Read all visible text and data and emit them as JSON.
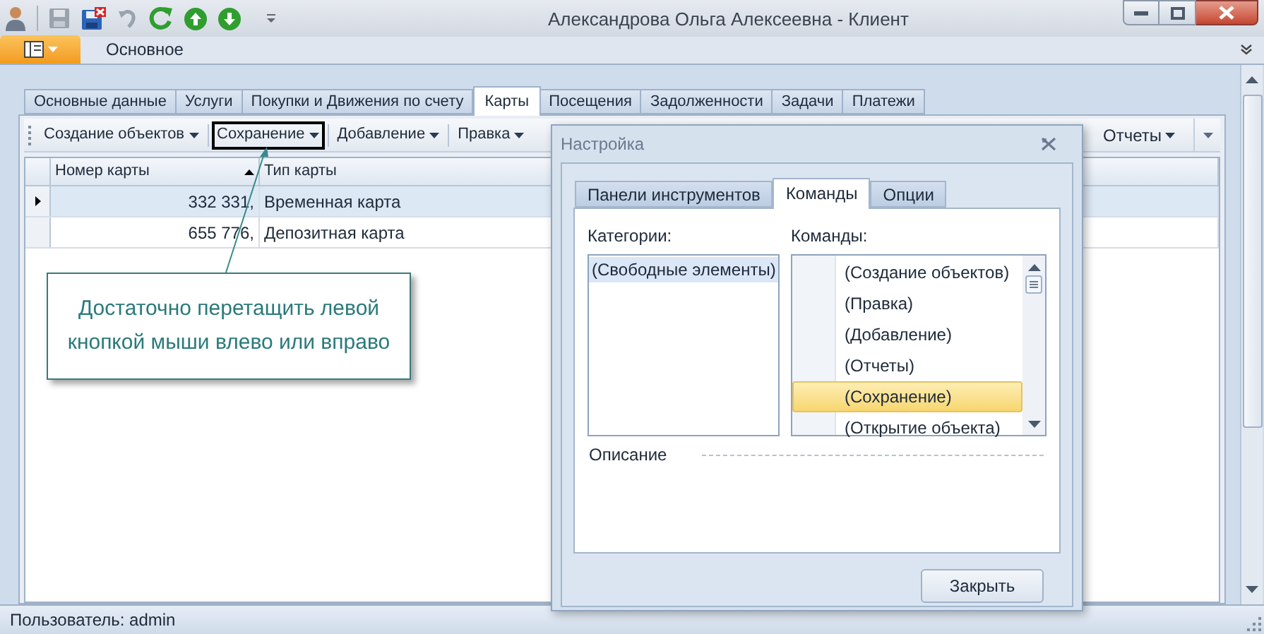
{
  "window": {
    "title": "Александрова Ольга Алексеевна - Клиент"
  },
  "ribbon_tab": "Основное",
  "tabs": [
    {
      "label": "Основные данные",
      "selected": false
    },
    {
      "label": "Услуги",
      "selected": false
    },
    {
      "label": "Покупки и Движения по счету",
      "selected": false
    },
    {
      "label": "Карты",
      "selected": true
    },
    {
      "label": "Посещения",
      "selected": false
    },
    {
      "label": "Задолженности",
      "selected": false
    },
    {
      "label": "Задачи",
      "selected": false
    },
    {
      "label": "Платежи",
      "selected": false
    }
  ],
  "toolbar": {
    "items": [
      {
        "label": "Создание объектов",
        "selected": false
      },
      {
        "label": "Сохранение",
        "selected": true
      },
      {
        "label": "Добавление",
        "selected": false
      },
      {
        "label": "Правка",
        "selected": false
      }
    ],
    "right_item": {
      "label": "Отчеты"
    }
  },
  "grid": {
    "columns": [
      {
        "label": "Номер карты",
        "sorted": true
      },
      {
        "label": "Тип карты",
        "sorted": false
      }
    ],
    "rows": [
      {
        "cells": [
          "332 331,",
          "Временная карта"
        ],
        "selected": true
      },
      {
        "cells": [
          "655 776,",
          "Депозитная карта"
        ],
        "selected": false
      }
    ]
  },
  "callout": {
    "text": "Достаточно перетащить левой кнопкой мыши влево или вправо"
  },
  "dialog": {
    "title": "Настройка",
    "tabs": [
      {
        "label": "Панели инструментов",
        "selected": false
      },
      {
        "label": "Команды",
        "selected": true
      },
      {
        "label": "Опции",
        "selected": false
      }
    ],
    "categories_label": "Категории:",
    "categories": [
      {
        "label": "(Свободные элементы)",
        "selected": true
      }
    ],
    "commands_label": "Команды:",
    "commands": [
      {
        "label": "(Создание объектов)",
        "selected": false
      },
      {
        "label": "(Правка)",
        "selected": false
      },
      {
        "label": "(Добавление)",
        "selected": false
      },
      {
        "label": "(Отчеты)",
        "selected": false
      },
      {
        "label": "(Сохранение)",
        "selected": true
      },
      {
        "label": "(Открытие объекта)",
        "selected": false
      }
    ],
    "description_label": "Описание",
    "close_button": "Закрыть"
  },
  "status_bar": {
    "text": "Пользователь: admin"
  }
}
